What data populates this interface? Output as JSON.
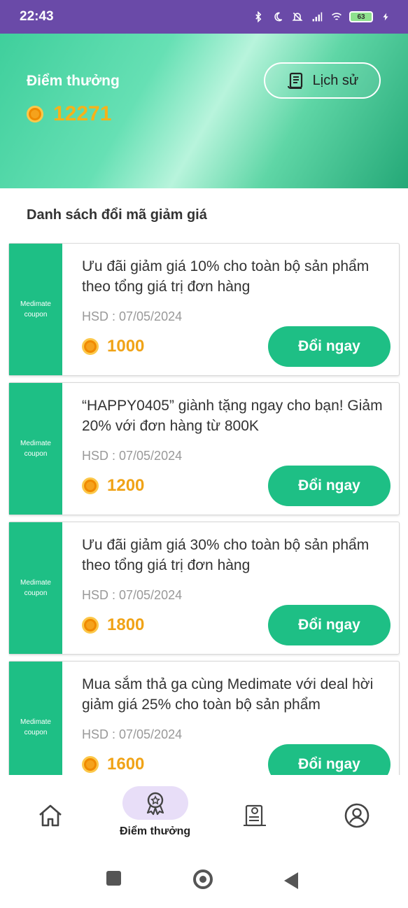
{
  "status_bar": {
    "time": "22:43",
    "icons": [
      "bluetooth-icon",
      "moon-icon",
      "bell-off-icon",
      "signal-icon",
      "wifi-icon",
      "battery-icon",
      "charging-icon"
    ],
    "battery": "63"
  },
  "header": {
    "title": "Điểm thưởng",
    "points": "12271",
    "history_label": "Lịch sử"
  },
  "section": {
    "title": "Danh sách đổi mã giảm giá"
  },
  "coupons": [
    {
      "tag_line1": "Medimate",
      "tag_line2": "coupon",
      "description": "Ưu đãi giảm giá 10% cho toàn bộ sản phẩm theo tổng giá trị đơn hàng",
      "expiry": "HSD : 07/05/2024",
      "price": "1000",
      "button": "Đổi ngay"
    },
    {
      "tag_line1": "Medimate",
      "tag_line2": "coupon",
      "description": "“HAPPY0405” giành tặng ngay cho bạn! Giảm 20% với đơn hàng từ 800K",
      "expiry": "HSD : 07/05/2024",
      "price": "1200",
      "button": "Đổi ngay"
    },
    {
      "tag_line1": "Medimate",
      "tag_line2": "coupon",
      "description": "Ưu đãi giảm giá 30% cho toàn bộ sản phẩm theo tổng giá trị đơn hàng",
      "expiry": "HSD : 07/05/2024",
      "price": "1800",
      "button": "Đổi ngay"
    },
    {
      "tag_line1": "Medimate",
      "tag_line2": "coupon",
      "description": "Mua sắm thả ga cùng Medimate với deal hời giảm giá 25% cho toàn bộ sản phẩm",
      "expiry": "HSD : 07/05/2024",
      "price": "1600",
      "button": "Đổi ngay"
    }
  ],
  "bottom_nav": {
    "active_label": "Điểm thưởng",
    "items": [
      "home-icon",
      "rewards-icon",
      "orders-icon",
      "profile-icon"
    ]
  },
  "colors": {
    "accent": "#1ebf85",
    "coin": "#f5a21c",
    "status_bar": "#6a4aa8",
    "active_pill": "#e8def8"
  }
}
